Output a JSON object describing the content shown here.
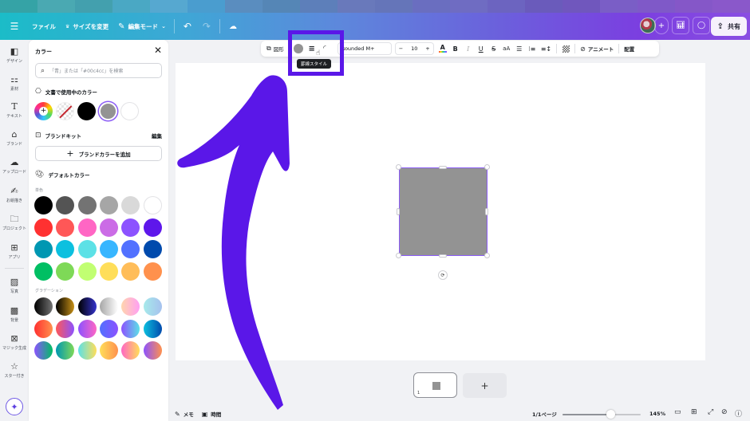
{
  "header": {
    "menu_icon": "hamburger-icon",
    "file": "ファイル",
    "resize": "サイズを変更",
    "edit_mode": "編集モード",
    "share": "共有"
  },
  "sidebar": {
    "items": [
      {
        "label": "デザイン",
        "icon": "layout-icon"
      },
      {
        "label": "素材",
        "icon": "shapes-icon"
      },
      {
        "label": "テキスト",
        "icon": "text-icon"
      },
      {
        "label": "ブランド",
        "icon": "brand-icon"
      },
      {
        "label": "アップロード",
        "icon": "upload-icon"
      },
      {
        "label": "お絵描き",
        "icon": "draw-icon"
      },
      {
        "label": "プロジェクト",
        "icon": "folder-icon"
      },
      {
        "label": "アプリ",
        "icon": "apps-icon"
      },
      {
        "label": "写真",
        "icon": "photo-icon"
      },
      {
        "label": "背景",
        "icon": "background-icon"
      },
      {
        "label": "マジック生成",
        "icon": "magic-media-icon"
      },
      {
        "label": "スター付き",
        "icon": "star-icon"
      }
    ]
  },
  "color_panel": {
    "title": "カラー",
    "search_placeholder": "「青」または「#00c4cc」を検索",
    "doc_colors_title": "文書で使用中のカラー",
    "doc_colors": [
      "#000000",
      "#939393",
      "#ffffff"
    ],
    "brand_kit_title": "ブランドキット",
    "brand_kit_edit": "編集",
    "add_brand_color": "ブランドカラーを追加",
    "default_colors_title": "デフォルトカラー",
    "solid_label": "単色",
    "solid_colors": [
      "#000000",
      "#545454",
      "#737373",
      "#a6a6a6",
      "#d9d9d9",
      "#ffffff",
      "#ff3131",
      "#ff5757",
      "#ff66c4",
      "#cb6ce6",
      "#8c52ff",
      "#5e17eb",
      "#0097b2",
      "#0cc0df",
      "#5ce1e6",
      "#38b6ff",
      "#5271ff",
      "#004aad",
      "#00bf63",
      "#7ed957",
      "#c1ff72",
      "#ffde59",
      "#ffbd59",
      "#ff914d"
    ],
    "gradient_label": "グラデーション",
    "gradients": [
      [
        "#000000",
        "#737373"
      ],
      [
        "#000000",
        "#c89116"
      ],
      [
        "#000000",
        "#3533cd"
      ],
      [
        "#a6a6a6",
        "#ffffff"
      ],
      [
        "#ffd5ac",
        "#ff9ff3"
      ],
      [
        "#a6eaea",
        "#a6c1ee"
      ],
      [
        "#ff3131",
        "#ff914d"
      ],
      [
        "#ff5757",
        "#8c52ff"
      ],
      [
        "#8c52ff",
        "#ff66c4"
      ],
      [
        "#5170ff",
        "#8c52ff"
      ],
      [
        "#8c52ff",
        "#5ce1e6"
      ],
      [
        "#0cc0df",
        "#004aad"
      ],
      [
        "#8c52ff",
        "#00bf63"
      ],
      [
        "#0097b2",
        "#7ed957"
      ],
      [
        "#5ce1e6",
        "#ffde59"
      ],
      [
        "#ffde59",
        "#ff914d"
      ],
      [
        "#ff66c4",
        "#ffde59"
      ],
      [
        "#8c52ff",
        "#ff914d"
      ]
    ]
  },
  "toolbar": {
    "shape": "図形",
    "font": "Rounded M+",
    "font_size": "10",
    "animate": "アニメート",
    "position": "配置",
    "tooltip": "罫線スタイル"
  },
  "canvas": {
    "shape_color": "#939393",
    "arrow_color": "#5a17e8",
    "highlight_color": "#5a17e8"
  },
  "pages": {
    "current_thumb_number": "1",
    "add_page": "+"
  },
  "footer": {
    "notes": "メモ",
    "timer": "時間",
    "page_indicator": "1/1ページ",
    "zoom_percent": "145%",
    "zoom_fraction": 0.62
  }
}
